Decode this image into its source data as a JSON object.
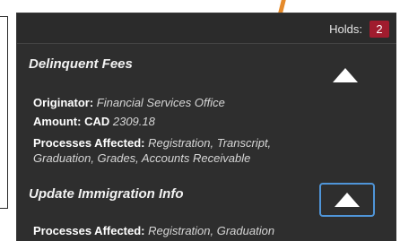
{
  "holds": {
    "label": "Holds:",
    "count": "2",
    "badge_color": "#a01c2e"
  },
  "holds_list": [
    {
      "title": "Delinquent Fees",
      "originator_label": "Originator:",
      "originator_value": "Financial Services Office",
      "amount_label": "Amount:",
      "amount_currency": "CAD",
      "amount_value": "2309.18",
      "processes_label": "Processes Affected:",
      "processes_value": "Registration, Transcript, Graduation, Grades, Accounts Receivable",
      "toggle_icon": "triangle-up-icon"
    },
    {
      "title": "Update Immigration Info",
      "processes_label": "Processes Affected:",
      "processes_value": "Registration, Graduation",
      "toggle_icon": "triangle-up-icon",
      "focused": true
    }
  ],
  "colors": {
    "panel_bg": "#2e2e2e",
    "focus_ring": "#4f95d8",
    "accent": "#e58a2a"
  }
}
